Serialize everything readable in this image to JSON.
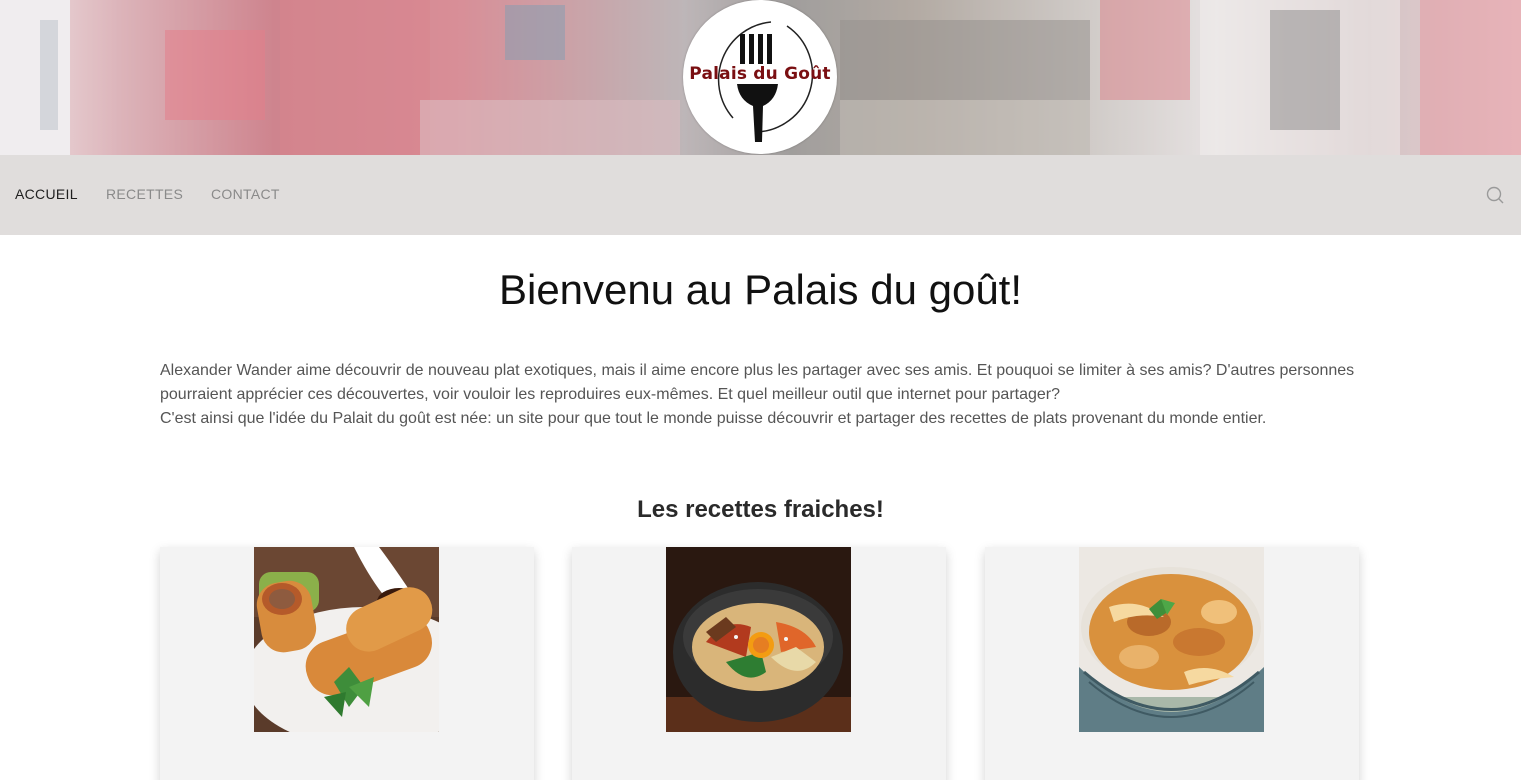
{
  "header": {
    "logo_text": "Palais du Goût"
  },
  "nav": {
    "items": [
      {
        "label": "ACCUEIL",
        "active": true
      },
      {
        "label": "RECETTES",
        "active": false
      },
      {
        "label": "CONTACT",
        "active": false
      }
    ],
    "search_icon": "search-icon"
  },
  "main": {
    "title": "Bienvenu au Palais du goût!",
    "intro_line1": "Alexander Wander aime découvrir de nouveau plat exotiques, mais il aime encore plus les partager avec ses amis. Et pouquoi se limiter à ses amis? D'autres personnes pourraient apprécier ces découvertes, voir vouloir les reproduires eux-mêmes. Et quel meilleur outil que internet pour partager?",
    "intro_line2": "C'est ainsi que l'idée du Palait du goût est née: un site pour que tout le monde puisse découvrir et partager des recettes de plats provenant du monde entier.",
    "section_title": "Les recettes fraiches!"
  },
  "colors": {
    "nav_bg": "#e0dddc",
    "card_bg": "#f3f3f3",
    "logo_text": "#7a0f12"
  }
}
